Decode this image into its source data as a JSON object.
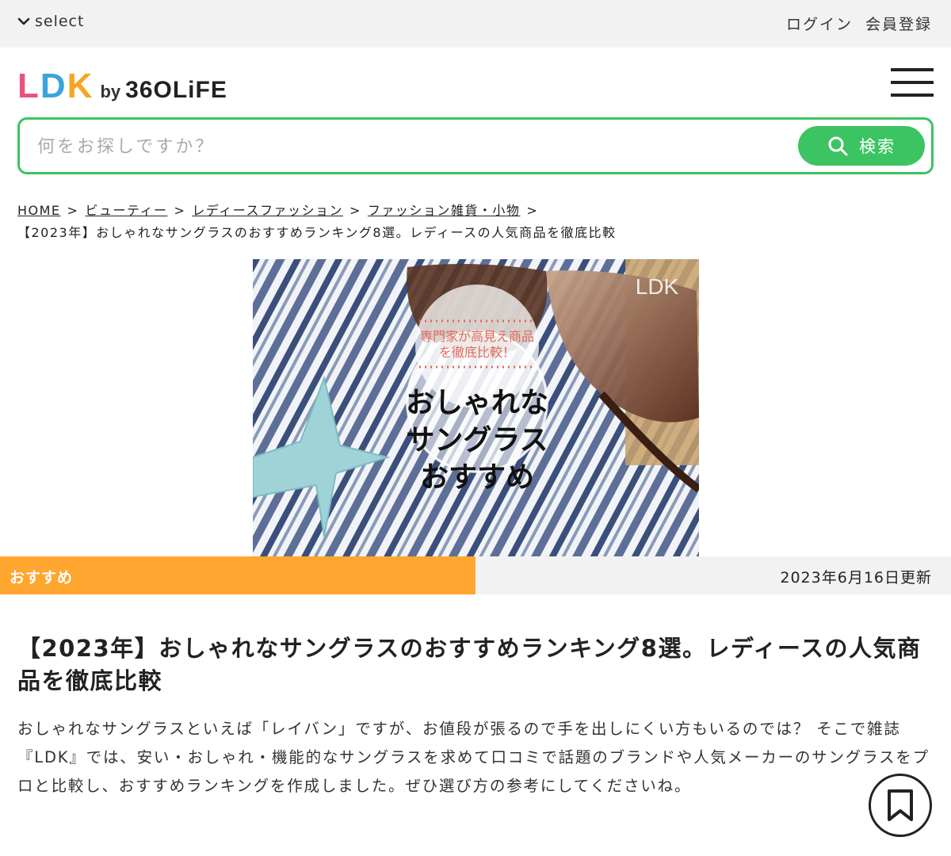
{
  "topbar": {
    "select_label": "select",
    "login_label": "ログイン",
    "register_label": "会員登録"
  },
  "logo": {
    "ldk": "LDK",
    "by": "by",
    "brand": "36OLiFE",
    "colors": {
      "L": "#e8537a",
      "D": "#3ba4de",
      "K": "#f5a623"
    }
  },
  "search": {
    "placeholder": "何をお探しですか？",
    "value": "",
    "button_label": "検索",
    "accent_color": "#3cc462"
  },
  "breadcrumb": {
    "items": [
      "HOME",
      "ビューティー",
      "レディースファッション",
      "ファッション雑貨・小物"
    ],
    "separator": ">",
    "current": "【2023年】おしゃれなサングラスのおすすめランキング8選。レディースの人気商品を徹底比較"
  },
  "hero": {
    "badge_line1": "専門家が高見え商品",
    "badge_line2": "を徹底比較！",
    "headline_line1": "おしゃれな",
    "headline_line2": "サングラス",
    "headline_line3": "おすすめ",
    "watermark": "LDK"
  },
  "meta": {
    "category_tag": "おすすめ",
    "updated": "2023年6月16日更新",
    "tag_color": "#ffa630"
  },
  "article": {
    "title": "【2023年】おしゃれなサングラスのおすすめランキング8選。レディースの人気商品を徹底比較",
    "lead": "おしゃれなサングラスといえば「レイバン」ですが、お値段が張るので手を出しにくい方もいるのでは？ そこで雑誌『LDK』では、安い・おしゃれ・機能的なサングラスを求めて口コミで話題のブランドや人気メーカーのサングラスをプロと比較し、おすすめランキングを作成しました。ぜひ選び方の参考にしてくださいね。"
  },
  "icons": {
    "select": "chevron-down-icon",
    "menu": "hamburger-icon",
    "search": "search-icon",
    "bookmark": "bookmark-icon"
  }
}
